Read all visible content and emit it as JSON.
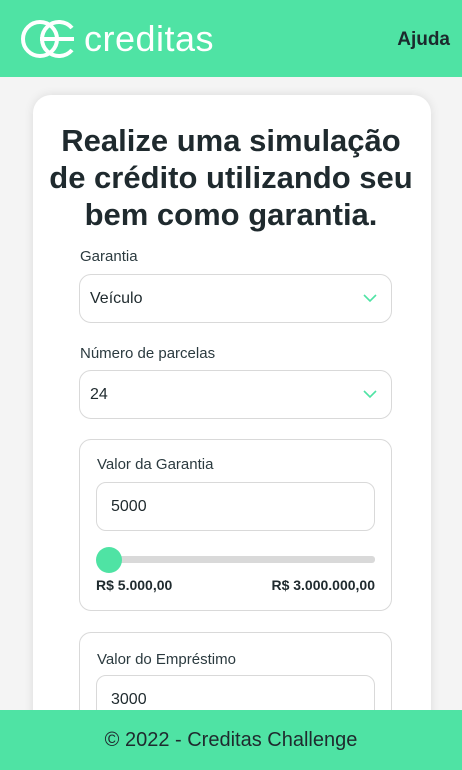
{
  "header": {
    "brand": "creditas",
    "help_label": "Ajuda"
  },
  "title": {
    "part1": "Realize uma ",
    "bold1": "simulação de crédito",
    "part2": " utilizando seu bem como garantia."
  },
  "form": {
    "guarantee_label": "Garantia",
    "guarantee_value": "Veículo",
    "installments_label": "Número de parcelas",
    "installments_value": "24",
    "guarantee_amount": {
      "label": "Valor da Garantia",
      "value": "5000",
      "min_label": "R$ 5.000,00",
      "max_label": "R$ 3.000.000,00",
      "slider_level": 0
    },
    "loan_amount": {
      "label": "Valor do Empréstimo",
      "value": "3000"
    }
  },
  "footer": {
    "text": "© 2022 - Creditas Challenge"
  },
  "colors": {
    "brand": "#4fe3a4",
    "text": "#1f2a2e"
  }
}
